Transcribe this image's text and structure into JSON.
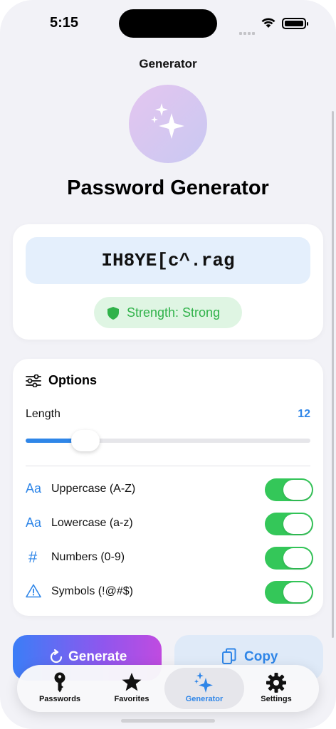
{
  "status_bar": {
    "time": "5:15"
  },
  "nav": {
    "title": "Generator"
  },
  "page": {
    "title": "Password Generator"
  },
  "password": {
    "value": "IH8YE[c^.rag",
    "strength_label": "Strength: Strong"
  },
  "options": {
    "header": "Options",
    "length_label": "Length",
    "length_value": "12",
    "length_fraction": 0.21,
    "toggles": [
      {
        "icon": "Aa",
        "label": "Uppercase (A-Z)",
        "on": true
      },
      {
        "icon": "Aa",
        "label": "Lowercase (a-z)",
        "on": true
      },
      {
        "icon": "#",
        "label": "Numbers (0-9)",
        "on": true
      },
      {
        "icon": "warning-triangle-icon",
        "label": "Symbols (!@#$)",
        "on": true
      }
    ]
  },
  "actions": {
    "generate_label": "Generate",
    "copy_label": "Copy"
  },
  "tabbar": {
    "items": [
      {
        "label": "Passwords",
        "icon": "key-icon"
      },
      {
        "label": "Favorites",
        "icon": "star-icon"
      },
      {
        "label": "Generator",
        "icon": "sparkles-icon",
        "active": true
      },
      {
        "label": "Settings",
        "icon": "gear-icon"
      }
    ]
  },
  "colors": {
    "accent": "#2f86e8",
    "success": "#34c759",
    "strength_text": "#30b24a"
  }
}
